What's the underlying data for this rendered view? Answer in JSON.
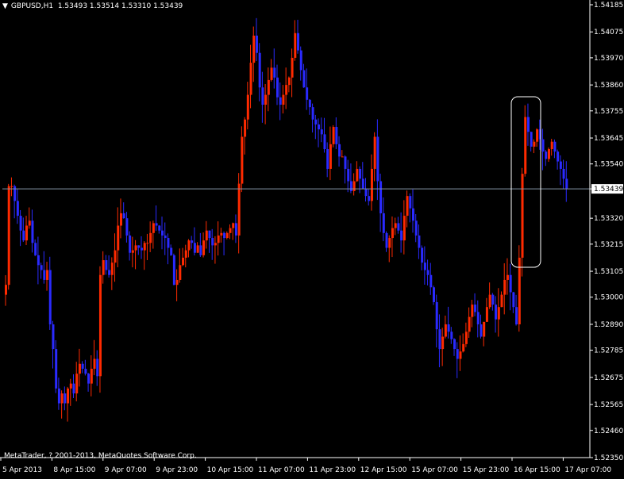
{
  "header": {
    "symbol_tf": "GBPUSD,H1",
    "ohlc": "1.53493 1.53514 1.53310 1.53439"
  },
  "footer": {
    "copyright": "MetaTrader, ? 2001-2013, MetaQuotes Software Corp."
  },
  "colors": {
    "bull": "#ff2a00",
    "bear": "#2a2aff",
    "axis": "#ffffff",
    "price_line": "#8899aa",
    "background": "#000000"
  },
  "chart_data": {
    "type": "candlestick",
    "title": "GBPUSD,H1",
    "ylim": [
      1.5235,
      1.54185
    ],
    "y_ticks": [
      "1.54185",
      "1.54075",
      "1.53970",
      "1.53860",
      "1.53755",
      "1.53645",
      "1.53540",
      "1.53439",
      "1.53320",
      "1.53215",
      "1.53105",
      "1.53000",
      "1.52890",
      "1.52785",
      "1.52675",
      "1.52565",
      "1.52460",
      "1.52350"
    ],
    "current_price": 1.53439,
    "x_tick_labels": [
      "5 Apr 2013",
      "8 Apr 15:00",
      "9 Apr 07:00",
      "9 Apr 23:00",
      "10 Apr 15:00",
      "11 Apr 07:00",
      "11 Apr 23:00",
      "12 Apr 15:00",
      "15 Apr 07:00",
      "15 Apr 23:00",
      "16 Apr 15:00",
      "17 Apr 07:00"
    ],
    "annotation": "rounded rectangle around breakout candle near 16 Apr 15:00",
    "closes": [
      1.5305,
      1.5345,
      1.5345,
      1.5339,
      1.5333,
      1.5327,
      1.5323,
      1.5329,
      1.5331,
      1.5322,
      1.5317,
      1.5313,
      1.5311,
      1.5307,
      1.5311,
      1.5289,
      1.5279,
      1.5263,
      1.5257,
      1.5261,
      1.5257,
      1.5263,
      1.5265,
      1.5261,
      1.5269,
      1.5273,
      1.5271,
      1.5269,
      1.5265,
      1.5271,
      1.5275,
      1.5268,
      1.5309,
      1.5315,
      1.5311,
      1.5309,
      1.5314,
      1.5319,
      1.5329,
      1.5334,
      1.5332,
      1.5325,
      1.5318,
      1.5319,
      1.5321,
      1.532,
      1.5319,
      1.5322,
      1.5322,
      1.5326,
      1.533,
      1.5329,
      1.5327,
      1.5325,
      1.5324,
      1.532,
      1.5317,
      1.5305,
      1.5307,
      1.5313,
      1.5316,
      1.5319,
      1.5323,
      1.5322,
      1.5318,
      1.5321,
      1.5317,
      1.5323,
      1.5327,
      1.5324,
      1.5321,
      1.5322,
      1.5325,
      1.5326,
      1.5324,
      1.5326,
      1.5328,
      1.533,
      1.5325,
      1.5346,
      1.5365,
      1.5372,
      1.5382,
      1.5395,
      1.5406,
      1.5399,
      1.5385,
      1.5378,
      1.5382,
      1.5388,
      1.5393,
      1.5389,
      1.5381,
      1.5378,
      1.5382,
      1.5386,
      1.5389,
      1.5397,
      1.5407,
      1.54,
      1.5392,
      1.5385,
      1.538,
      1.5377,
      1.5372,
      1.537,
      1.5368,
      1.5366,
      1.536,
      1.5352,
      1.5362,
      1.5369,
      1.5362,
      1.5357,
      1.5357,
      1.5352,
      1.5347,
      1.5343,
      1.5347,
      1.5352,
      1.5348,
      1.5344,
      1.5341,
      1.5339,
      1.5352,
      1.5365,
      1.5347,
      1.5334,
      1.5326,
      1.532,
      1.5324,
      1.5328,
      1.533,
      1.5327,
      1.5323,
      1.5333,
      1.5341,
      1.5336,
      1.5331,
      1.5325,
      1.532,
      1.5314,
      1.5311,
      1.5309,
      1.5304,
      1.5298,
      1.5287,
      1.5279,
      1.5284,
      1.5289,
      1.5286,
      1.5283,
      1.5279,
      1.5275,
      1.5278,
      1.5281,
      1.5286,
      1.5292,
      1.5297,
      1.5294,
      1.5289,
      1.5284,
      1.529,
      1.5296,
      1.5301,
      1.5297,
      1.5291,
      1.5296,
      1.5301,
      1.5307,
      1.5309,
      1.5302,
      1.5296,
      1.5289,
      1.5316,
      1.535,
      1.5373,
      1.5367,
      1.5361,
      1.5363,
      1.5368,
      1.5364,
      1.5359,
      1.5356,
      1.536,
      1.5363,
      1.5359,
      1.5355,
      1.5352,
      1.5348,
      1.5344
    ]
  }
}
